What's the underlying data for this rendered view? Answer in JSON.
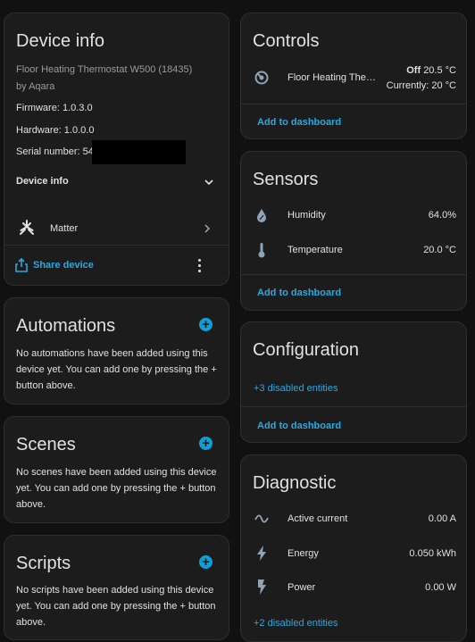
{
  "device_info": {
    "title": "Device info",
    "model": "Floor Heating Thermostat W500 (18435)",
    "manufacturer": "by Aqara",
    "firmware": "Firmware: 1.0.3.0",
    "hardware": "Hardware: 1.0.0.0",
    "serial": "Serial number: 54",
    "expander_label": "Device info",
    "integration": "Matter",
    "share_label": "Share device"
  },
  "automations": {
    "title": "Automations",
    "text": "No automations have been added using this device yet. You can add one by pressing the + button above."
  },
  "scenes": {
    "title": "Scenes",
    "text": "No scenes have been added using this device yet. You can add one by pressing the + button above."
  },
  "scripts": {
    "title": "Scripts",
    "text": "No scripts have been added using this device yet. You can add one by pressing the + button above."
  },
  "controls": {
    "title": "Controls",
    "entity_name": "Floor Heating The…",
    "state": "Off",
    "setpoint": "20.5 °C",
    "current": "Currently: 20 °C",
    "add_label": "Add to dashboard"
  },
  "sensors": {
    "title": "Sensors",
    "rows": [
      {
        "label": "Humidity",
        "value": "64.0%",
        "icon": "water-percent-icon"
      },
      {
        "label": "Temperature",
        "value": "20.0 °C",
        "icon": "thermometer-icon"
      }
    ],
    "add_label": "Add to dashboard"
  },
  "configuration": {
    "title": "Configuration",
    "disabled": "+3 disabled entities",
    "add_label": "Add to dashboard"
  },
  "diagnostic": {
    "title": "Diagnostic",
    "rows": [
      {
        "label": "Active current",
        "value": "0.00 A",
        "icon": "current-ac-icon"
      },
      {
        "label": "Energy",
        "value": "0.050 kWh",
        "icon": "lightning-bolt-icon"
      },
      {
        "label": "Power",
        "value": "0.00 W",
        "icon": "flash-icon"
      }
    ],
    "disabled": "+2 disabled entities"
  },
  "colors": {
    "accent": "#0e9fd8",
    "link": "#29a9e0",
    "card": "#1c1c1c",
    "background": "#111111"
  }
}
